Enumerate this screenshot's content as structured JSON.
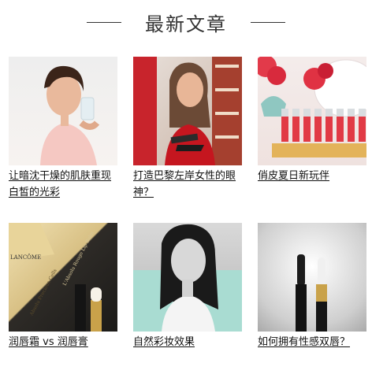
{
  "section": {
    "title": "最新文章"
  },
  "articles": [
    {
      "caption": "让暗沈干燥的肌肤重现白皙的光彩",
      "image": "woman-drinking-water-photo"
    },
    {
      "caption": "打造巴黎左岸女性的眼神？",
      "image": "woman-holding-eyeshadow-palette-photo"
    },
    {
      "caption": "俏皮夏日新玩伴",
      "image": "roses-and-lipstick-collection-photo"
    },
    {
      "caption": "润唇霜 vs 润唇膏",
      "image": "lancome-lip-balm-products-photo"
    },
    {
      "caption": "自然彩妆效果",
      "image": "woman-portrait-photo"
    },
    {
      "caption": "如何拥有性感双唇？",
      "image": "lipstick-tubes-photo"
    }
  ],
  "brand_text": {
    "logo": "LANCÔME",
    "product_script": "L'Absolu Rouge Lip Balm",
    "product_script2": "Absolu Precious Cells"
  }
}
